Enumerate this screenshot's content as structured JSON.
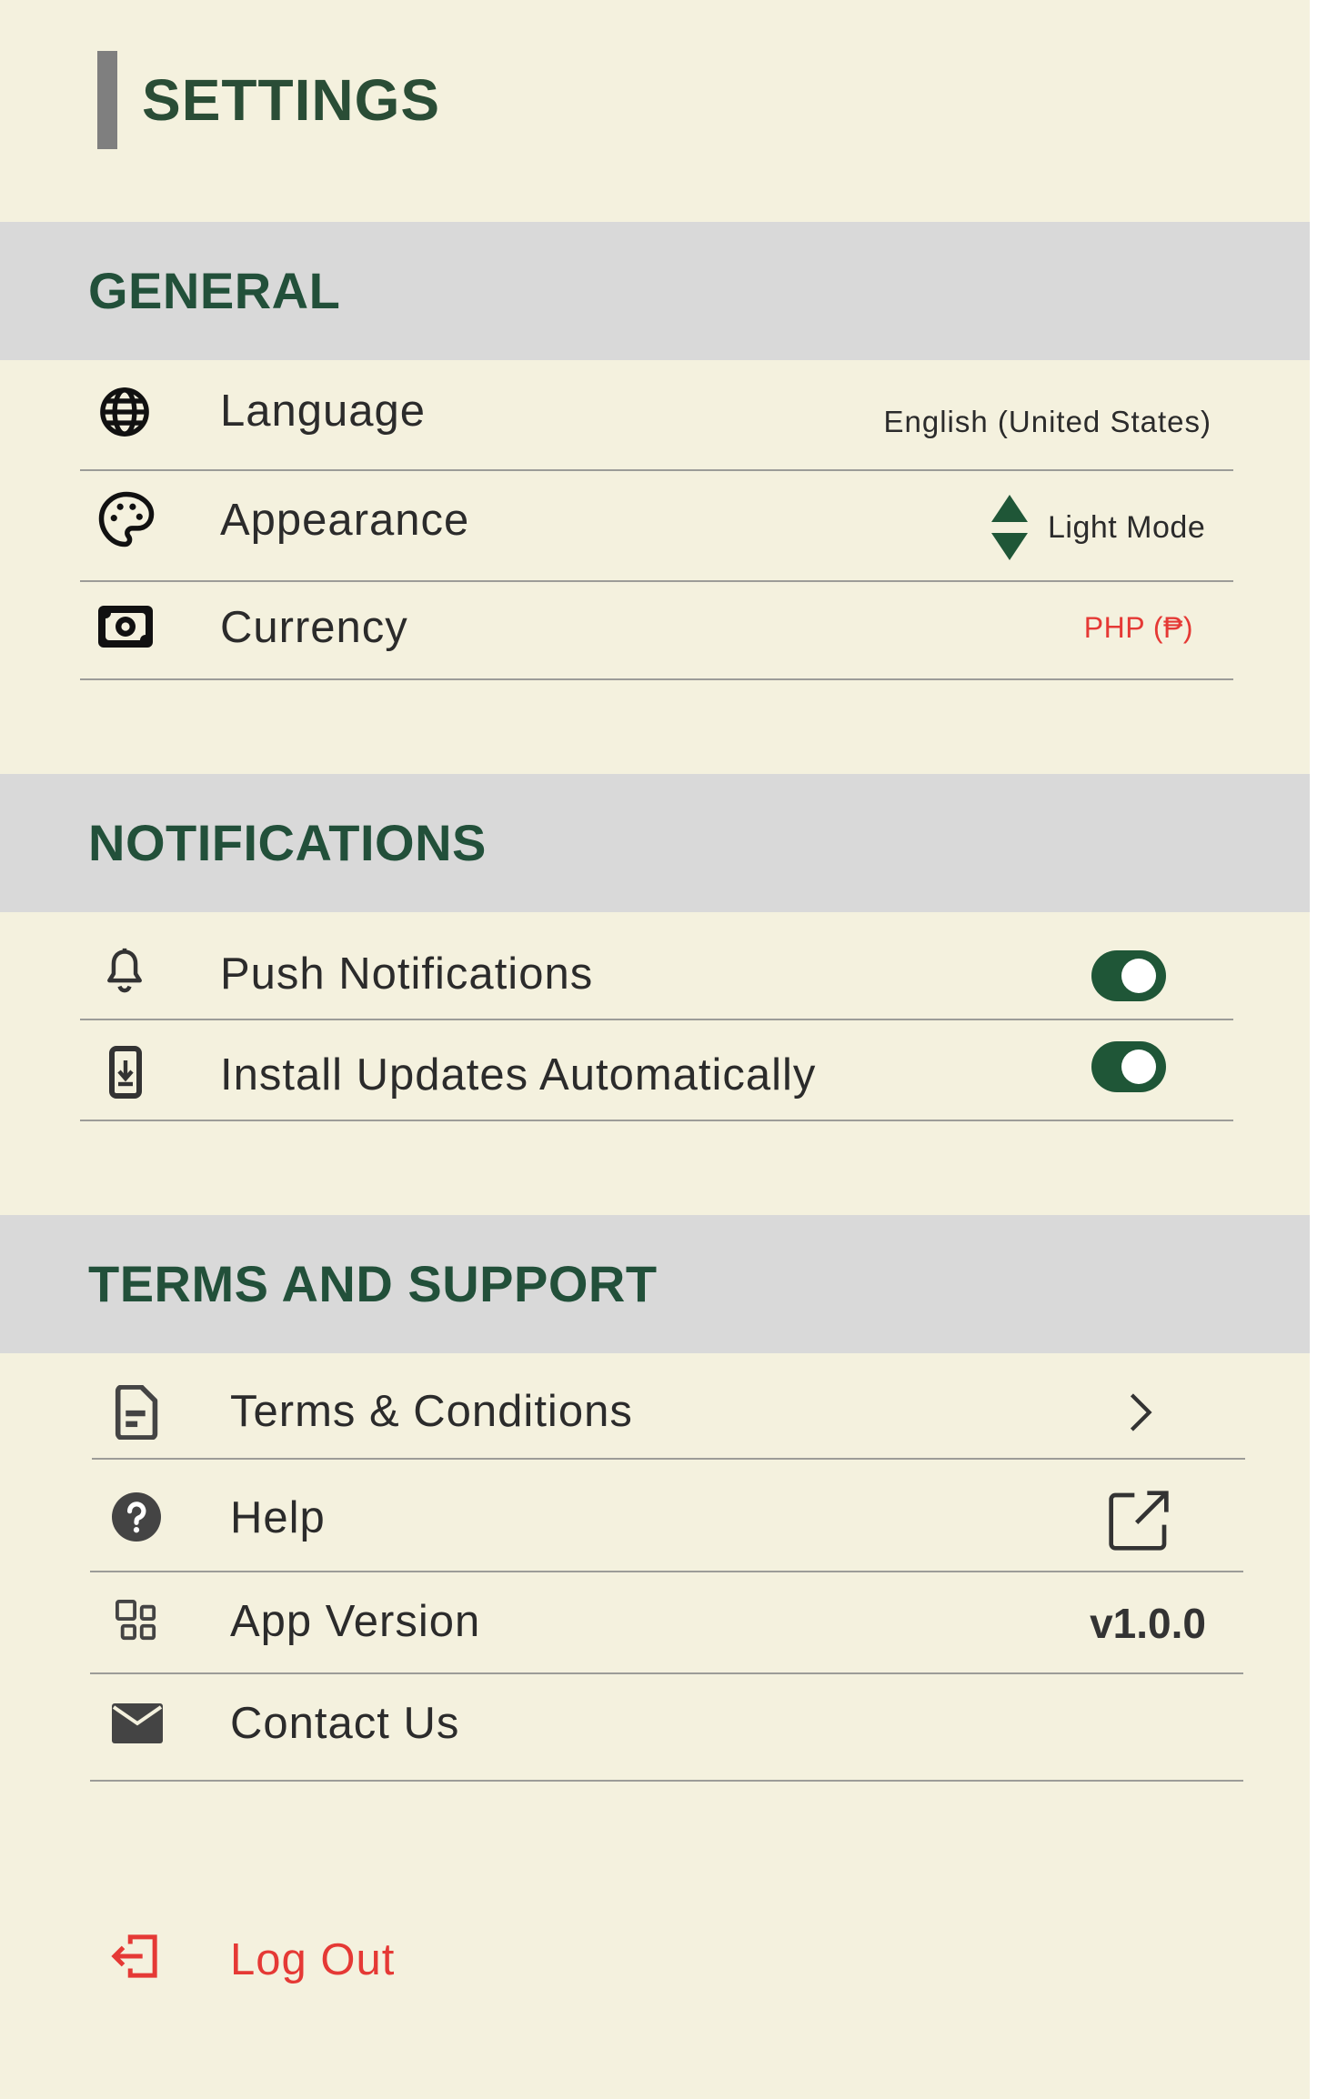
{
  "page": {
    "title": "SETTINGS"
  },
  "sections": {
    "general": {
      "title": "GENERAL",
      "language": {
        "label": "Language",
        "value": "English (United States)",
        "icon": "globe-icon"
      },
      "appearance": {
        "label": "Appearance",
        "value": "Light Mode",
        "icon": "palette-icon"
      },
      "currency": {
        "label": "Currency",
        "value": "PHP (₱)",
        "value_color": "#e53935",
        "icon": "money-icon"
      }
    },
    "notifications": {
      "title": "NOTIFICATIONS",
      "push": {
        "label": "Push Notifications",
        "enabled": true,
        "icon": "bell-icon"
      },
      "updates": {
        "label": "Install Updates Automatically",
        "enabled": true,
        "icon": "download-icon"
      }
    },
    "support": {
      "title": "TERMS AND SUPPORT",
      "terms": {
        "label": "Terms & Conditions",
        "icon": "document-icon"
      },
      "help": {
        "label": "Help",
        "icon": "help-icon"
      },
      "version": {
        "label": "App Version",
        "value": "v1.0.0",
        "icon": "apps-icon"
      },
      "contact": {
        "label": "Contact Us",
        "icon": "mail-icon"
      }
    }
  },
  "logout": {
    "label": "Log Out",
    "icon": "logout-icon",
    "color": "#e53935"
  },
  "colors": {
    "background": "#f4f1de",
    "section_header_bg": "#d9d9d9",
    "heading": "#22503a",
    "toggle_on": "#1f5637"
  }
}
